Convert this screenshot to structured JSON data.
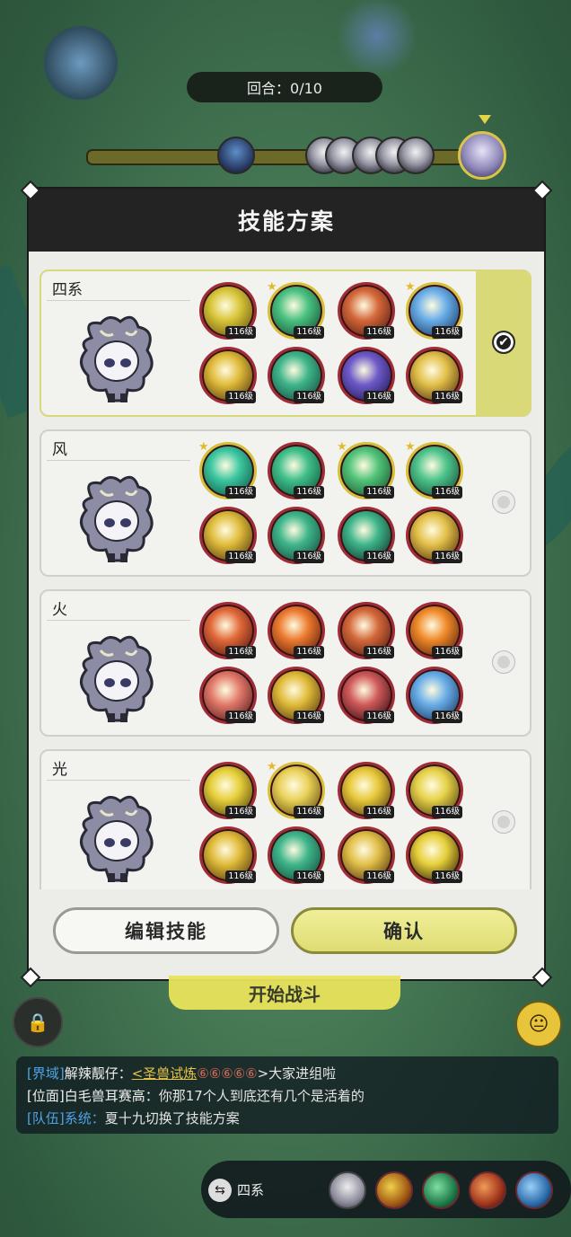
{
  "round": {
    "label": "回合：0/10"
  },
  "panel": {
    "title": "技能方案"
  },
  "plans": [
    {
      "name": "四系",
      "selected": true,
      "skills": [
        {
          "level": "116级",
          "star": false,
          "color": "#d9c63a",
          "tone": "#6a5a10"
        },
        {
          "level": "116级",
          "star": true,
          "color": "#4ac280",
          "tone": "#15553a"
        },
        {
          "level": "116级",
          "star": false,
          "color": "#d4683a",
          "tone": "#5a1e10"
        },
        {
          "level": "116级",
          "star": true,
          "color": "#6aaee8",
          "tone": "#1a3e6a"
        },
        {
          "level": "116级",
          "star": false,
          "color": "#e0bb3a",
          "tone": "#5a3e0e"
        },
        {
          "level": "116级",
          "star": false,
          "color": "#3fb58a",
          "tone": "#155040"
        },
        {
          "level": "116级",
          "star": false,
          "color": "#6e5ac8",
          "tone": "#221a5a"
        },
        {
          "level": "116级",
          "star": false,
          "color": "#e2c04a",
          "tone": "#5a3a10"
        }
      ]
    },
    {
      "name": "风",
      "selected": false,
      "skills": [
        {
          "level": "116级",
          "star": true,
          "color": "#3cc7a0",
          "tone": "#0f5a4a"
        },
        {
          "level": "116级",
          "star": false,
          "color": "#40bf8a",
          "tone": "#125a40"
        },
        {
          "level": "116级",
          "star": true,
          "color": "#52c47a",
          "tone": "#1a5a30"
        },
        {
          "level": "116级",
          "star": true,
          "color": "#4fc48c",
          "tone": "#15553a"
        },
        {
          "level": "116级",
          "star": false,
          "color": "#dfbd3c",
          "tone": "#5a3e0e"
        },
        {
          "level": "116级",
          "star": false,
          "color": "#3fb58a",
          "tone": "#155040"
        },
        {
          "level": "116级",
          "star": false,
          "color": "#3fb58a",
          "tone": "#103a2e"
        },
        {
          "level": "116级",
          "star": false,
          "color": "#e2c04a",
          "tone": "#5a3a10"
        }
      ]
    },
    {
      "name": "火",
      "selected": false,
      "skills": [
        {
          "level": "116级",
          "star": false,
          "color": "#e2693a",
          "tone": "#5a1a0e"
        },
        {
          "level": "116级",
          "star": false,
          "color": "#ec7a30",
          "tone": "#5e200a"
        },
        {
          "level": "116级",
          "star": false,
          "color": "#d4683a",
          "tone": "#5a1e10"
        },
        {
          "level": "116级",
          "star": false,
          "color": "#f08a2a",
          "tone": "#5e260a"
        },
        {
          "level": "116级",
          "star": false,
          "color": "#e27a6a",
          "tone": "#5a1e1e"
        },
        {
          "level": "116级",
          "star": false,
          "color": "#e0bb3a",
          "tone": "#5a3e0e"
        },
        {
          "level": "116级",
          "star": false,
          "color": "#d05a5a",
          "tone": "#3a0e14"
        },
        {
          "level": "116级",
          "star": false,
          "color": "#6aaee8",
          "tone": "#1a3e6a"
        }
      ]
    },
    {
      "name": "光",
      "selected": false,
      "skills": [
        {
          "level": "116级",
          "star": false,
          "color": "#e6cf3a",
          "tone": "#5a4a0e"
        },
        {
          "level": "116级",
          "star": true,
          "color": "#ead25a",
          "tone": "#6a5210"
        },
        {
          "level": "116级",
          "star": false,
          "color": "#e8c83a",
          "tone": "#5e4410"
        },
        {
          "level": "116级",
          "star": false,
          "color": "#e6d24a",
          "tone": "#5a4a10"
        },
        {
          "level": "116级",
          "star": false,
          "color": "#e0bb3a",
          "tone": "#5a3e0e"
        },
        {
          "level": "116级",
          "star": false,
          "color": "#3fb58a",
          "tone": "#155040"
        },
        {
          "level": "116级",
          "star": false,
          "color": "#e2c04a",
          "tone": "#5a3a10"
        },
        {
          "level": "116级",
          "star": false,
          "color": "#e6cf3a",
          "tone": "#3a2a08"
        }
      ]
    }
  ],
  "buttons": {
    "edit": "编辑技能",
    "confirm": "确认"
  },
  "start_button": "开始战斗",
  "chat": [
    {
      "tag": "[界域]",
      "name": "解辣靓仔：",
      "link": "<圣兽试炼",
      "icons": "⑥⑥⑥⑥⑥",
      "text": ">大家进组啦"
    },
    {
      "tag": "[位面]",
      "name": "白毛兽耳赛高：",
      "link": "",
      "icons": "",
      "text": "你那17个人到底还有几个是活着的"
    },
    {
      "tag": "[队伍]",
      "name": "系统：",
      "link": "",
      "icons": "",
      "text": "夏十九切换了技能方案"
    }
  ],
  "bottom_bar": {
    "plan_label": "四系"
  },
  "icons": {
    "lock": "lock-icon",
    "emoji": "emoji-face-icon",
    "swap": "swap-icon",
    "check": "check-icon"
  }
}
